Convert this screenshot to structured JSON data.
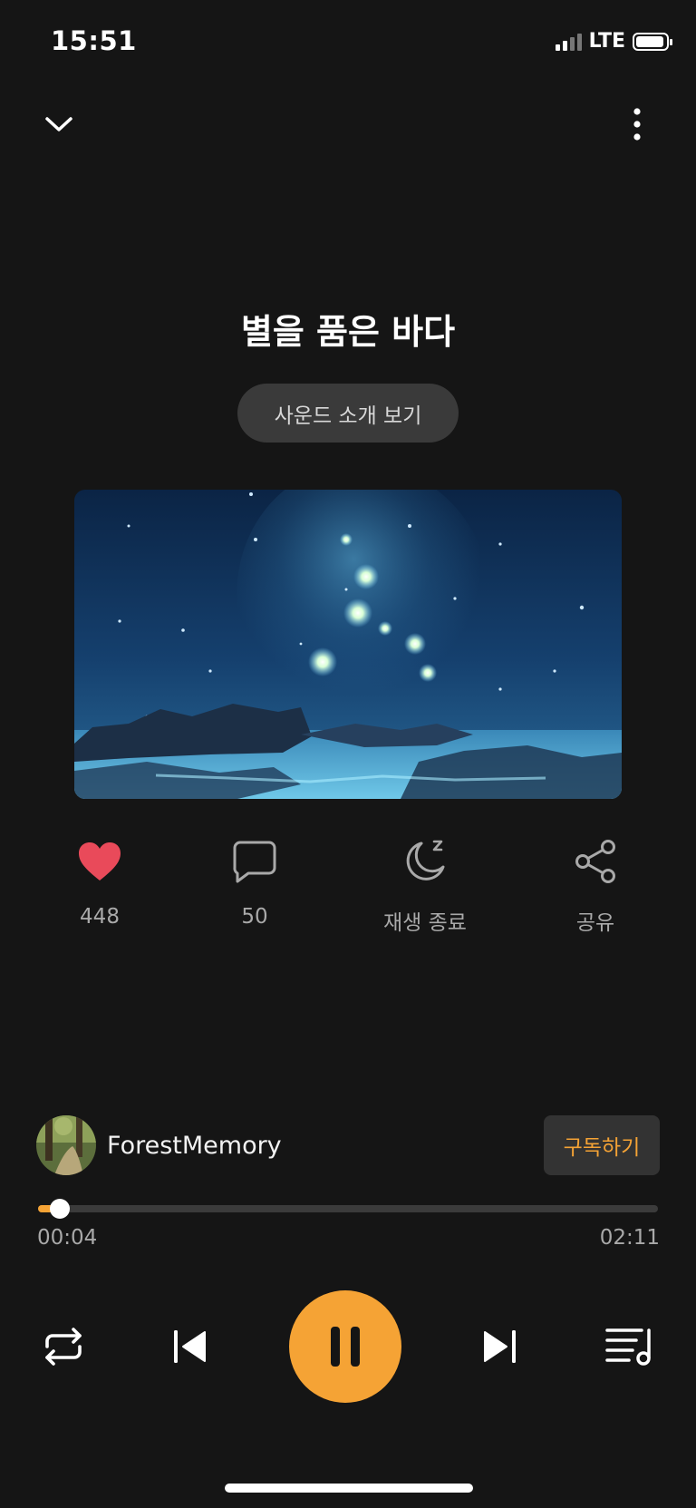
{
  "status_bar": {
    "time": "15:51",
    "network": "LTE"
  },
  "header": {
    "collapse_icon": "chevron-down-icon",
    "more_icon": "more-vertical-icon"
  },
  "track": {
    "title": "별을 품은 바다",
    "intro_button": "사운드 소개 보기"
  },
  "artwork": {
    "description_icon": "starry-sea-artwork",
    "colors": {
      "sky": "#123a63",
      "glow": "#7fd6ff"
    }
  },
  "actions": {
    "like_count": "448",
    "comment_count": "50",
    "sleep_timer_label": "재생 종료",
    "share_label": "공유"
  },
  "creator": {
    "name": "ForestMemory",
    "subscribe_label": "구독하기"
  },
  "player": {
    "current_time": "00:04",
    "duration": "02:11",
    "progress": 0.035,
    "state": "playing"
  },
  "colors": {
    "accent": "#f5a335",
    "like": "#e94a5a",
    "background": "#151515"
  }
}
